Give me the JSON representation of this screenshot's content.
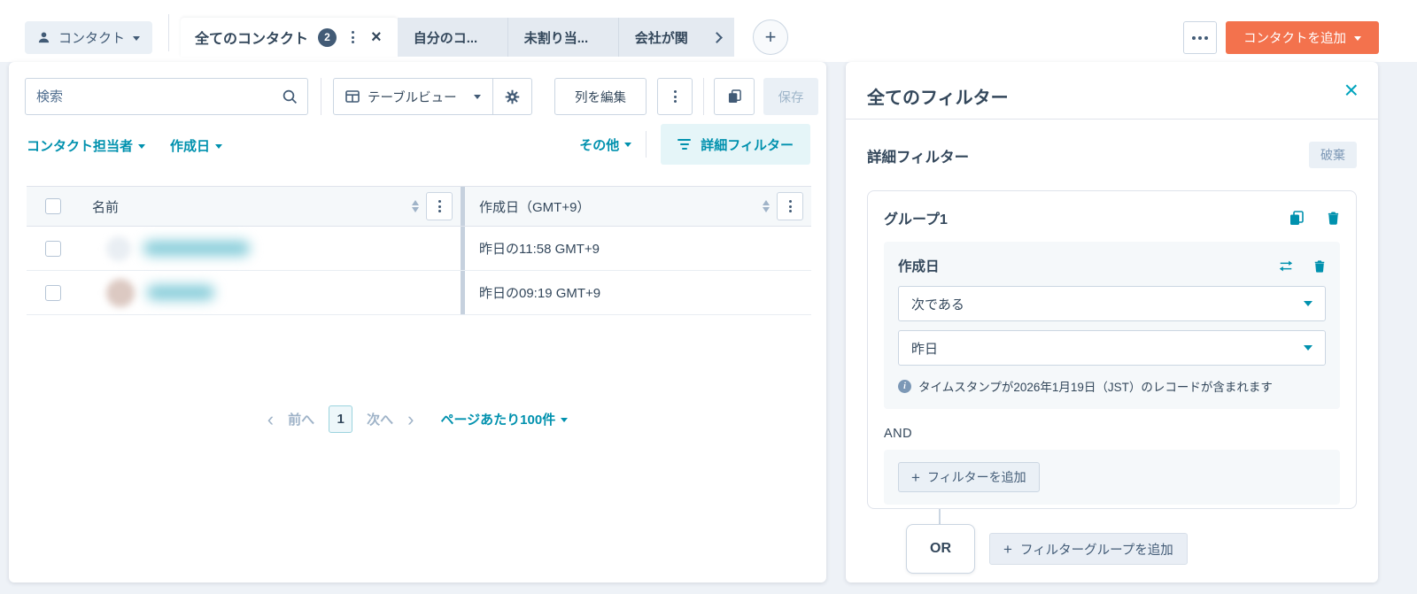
{
  "colors": {
    "accent_orange": "#f3724d",
    "link_teal": "#0091ae",
    "icon_teal": "#00a4bd",
    "text_navy": "#33475b",
    "badge_navy": "#425b76",
    "chip_bg": "#e5f5f8",
    "page_bg": "#eef2f7",
    "section_bg": "#f5f8fa",
    "border": "#cbd6e2"
  },
  "icons": {
    "person": "person silhouette",
    "search": "magnifier",
    "table_view": "grid",
    "gear": "settings gear",
    "copy": "duplicate sheets",
    "filter": "3 shrinking lines",
    "swap": "left-right arrows",
    "trash": "trash can",
    "close": "×",
    "plus": "+",
    "chevron_left": "‹",
    "chevron_right": "›",
    "info": "i",
    "kebab": "vertical dots",
    "ellipsis": "horizontal dots",
    "caret": "▾ triangle",
    "sort": "up/down triangles"
  },
  "topbar": {
    "object_switcher_label": "コンタクト",
    "tabs": [
      {
        "label": "全てのコンタクト",
        "badge": "2"
      },
      {
        "label": "自分のコ..."
      },
      {
        "label": "未割り当..."
      },
      {
        "label": "会社が関"
      }
    ],
    "add_contact_label": "コンタクトを追加"
  },
  "toolbar": {
    "search_placeholder": "検索",
    "view_selector_label": "テーブルビュー",
    "edit_columns_label": "列を編集",
    "save_label": "保存"
  },
  "quick_filters": {
    "owner_label": "コンタクト担当者",
    "create_date_label": "作成日",
    "more_label": "その他",
    "advanced_label": "詳細フィルター"
  },
  "table": {
    "columns": [
      "名前",
      "作成日（GMT+9）"
    ],
    "rows": [
      {
        "created": "昨日の11:58 GMT+9"
      },
      {
        "created": "昨日の09:19 GMT+9"
      }
    ]
  },
  "pagination": {
    "prev_label": "前へ",
    "page": "1",
    "next_label": "次へ",
    "per_page_label": "ページあたり100件"
  },
  "filter_panel": {
    "title": "全てのフィルター",
    "subtitle": "詳細フィルター",
    "discard_label": "破棄",
    "group": {
      "title": "グループ1",
      "field_label": "作成日",
      "operator_value": "次である",
      "value_value": "昨日",
      "info_text": "タイムスタンプが2026年1月19日（JST）のレコードが含まれます",
      "and_label": "AND",
      "add_filter_label": "フィルターを追加"
    },
    "or_label": "OR",
    "add_group_label": "フィルターグループを追加"
  }
}
